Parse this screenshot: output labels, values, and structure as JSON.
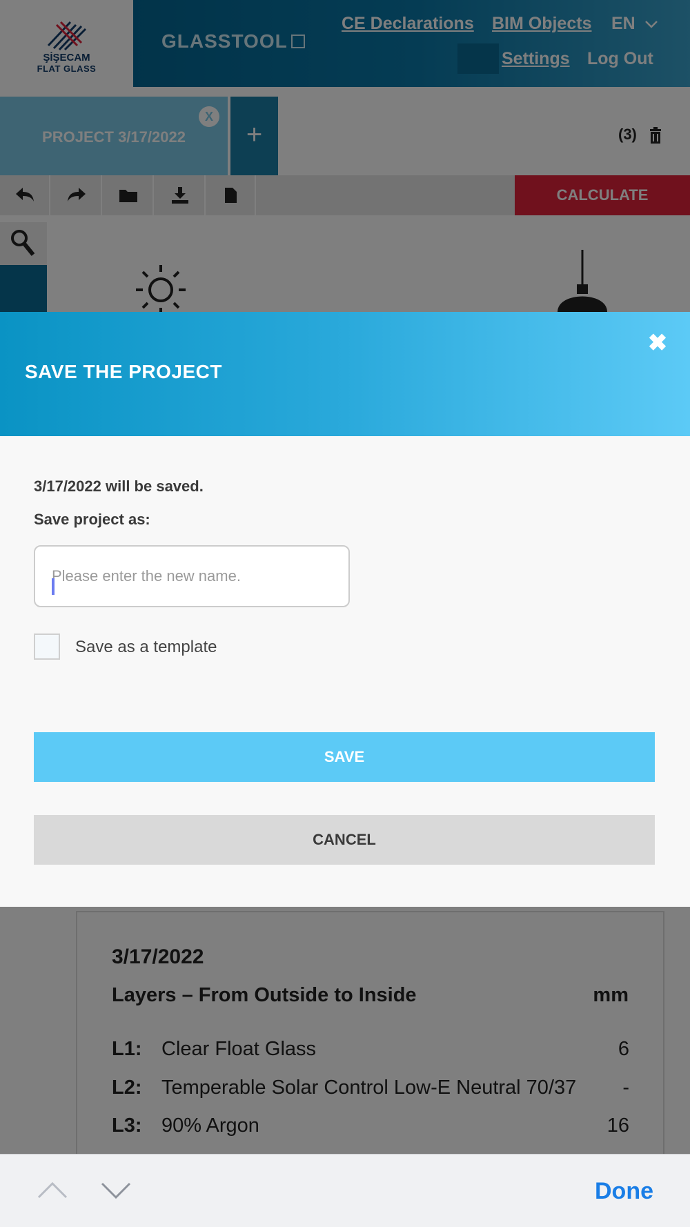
{
  "header": {
    "logo_title": "ŞİŞECAM",
    "logo_subtitle": "FLAT GLASS",
    "brand": "GLASSTOOL",
    "nav": {
      "ce_declarations": "CE Declarations",
      "bim_objects": "BIM Objects",
      "language": "EN",
      "settings": "Settings",
      "logout": "Log Out"
    }
  },
  "tabs": {
    "active_label": "PROJECT 3/17/2022",
    "close_label": "X",
    "add_label": "+",
    "count": "(3)"
  },
  "toolbar": {
    "calculate_label": "CALCULATE",
    "icons": [
      "undo-icon",
      "redo-icon",
      "folder-icon",
      "download-icon",
      "file-icon"
    ]
  },
  "modal": {
    "title": "SAVE THE PROJECT",
    "close_label": "✖",
    "message": "3/17/2022 will be saved.",
    "save_as_label": "Save project as:",
    "name_input": {
      "value": "",
      "placeholder": "Please enter the new name."
    },
    "template_label": "Save as a template",
    "template_checked": false,
    "save_label": "SAVE",
    "cancel_label": "CANCEL"
  },
  "summary": {
    "title": "3/17/2022",
    "layers_heading": "Layers – From Outside to Inside",
    "unit": "mm",
    "layers": [
      {
        "code": "L1:",
        "name": "Clear Float Glass",
        "value": "6"
      },
      {
        "code": "L2:",
        "name": "Temperable Solar Control Low-E Neutral 70/37",
        "value": "-"
      },
      {
        "code": "L3:",
        "name": "90% Argon",
        "value": "16"
      }
    ]
  },
  "keyboard_bar": {
    "done_label": "Done"
  },
  "colors": {
    "header_blue": "#005f8a",
    "tab_blue": "#7cc9e6",
    "calculate_red": "#e0223a",
    "modal_accent": "#5ccaf6",
    "done_blue": "#1a7ee6"
  }
}
